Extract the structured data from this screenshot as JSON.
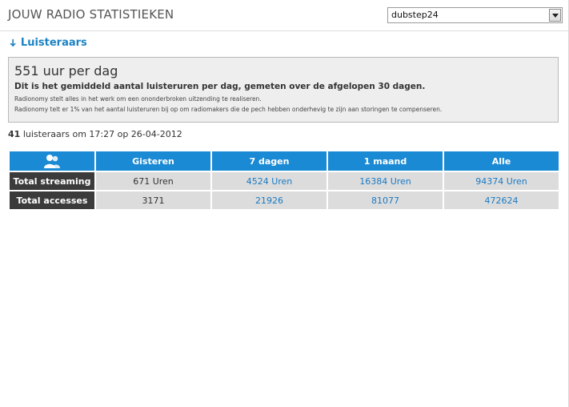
{
  "header": {
    "title": "JOUW RADIO STATISTIEKEN",
    "station_select": {
      "value": "dubstep24"
    }
  },
  "section": {
    "title": "Luisteraars",
    "icon": "arrow-down-icon"
  },
  "summary": {
    "headline": "551 uur per dag",
    "subtitle": "Dit is het gemiddeld aantal luisteruren per dag, gemeten over de afgelopen 30 dagen.",
    "note1": "Radionomy stelt alles in het werk om een ononderbroken uitzending te realiseren.",
    "note2": "Radionomy telt er 1% van het aantal luisteruren bij op om radiomakers die de pech hebben onderhevig te zijn aan storingen te compenseren."
  },
  "listeners": {
    "count": "41",
    "text": "luisteraars om 17:27 op 26-04-2012"
  },
  "table": {
    "header_icon": "users-icon",
    "columns": [
      "Gisteren",
      "7 dagen",
      "1 maand",
      "Alle"
    ],
    "rows": [
      {
        "label": "Total streaming",
        "values": [
          "671 Uren",
          "4524 Uren",
          "16384 Uren",
          "94374 Uren"
        ]
      },
      {
        "label": "Total accesses",
        "values": [
          "3171",
          "21926",
          "81077",
          "472624"
        ]
      }
    ]
  },
  "colors": {
    "accent": "#1b8ad4",
    "link": "#1a7ac4",
    "row_header": "#3b3b3b",
    "cell_bg": "#dcdcdc"
  }
}
